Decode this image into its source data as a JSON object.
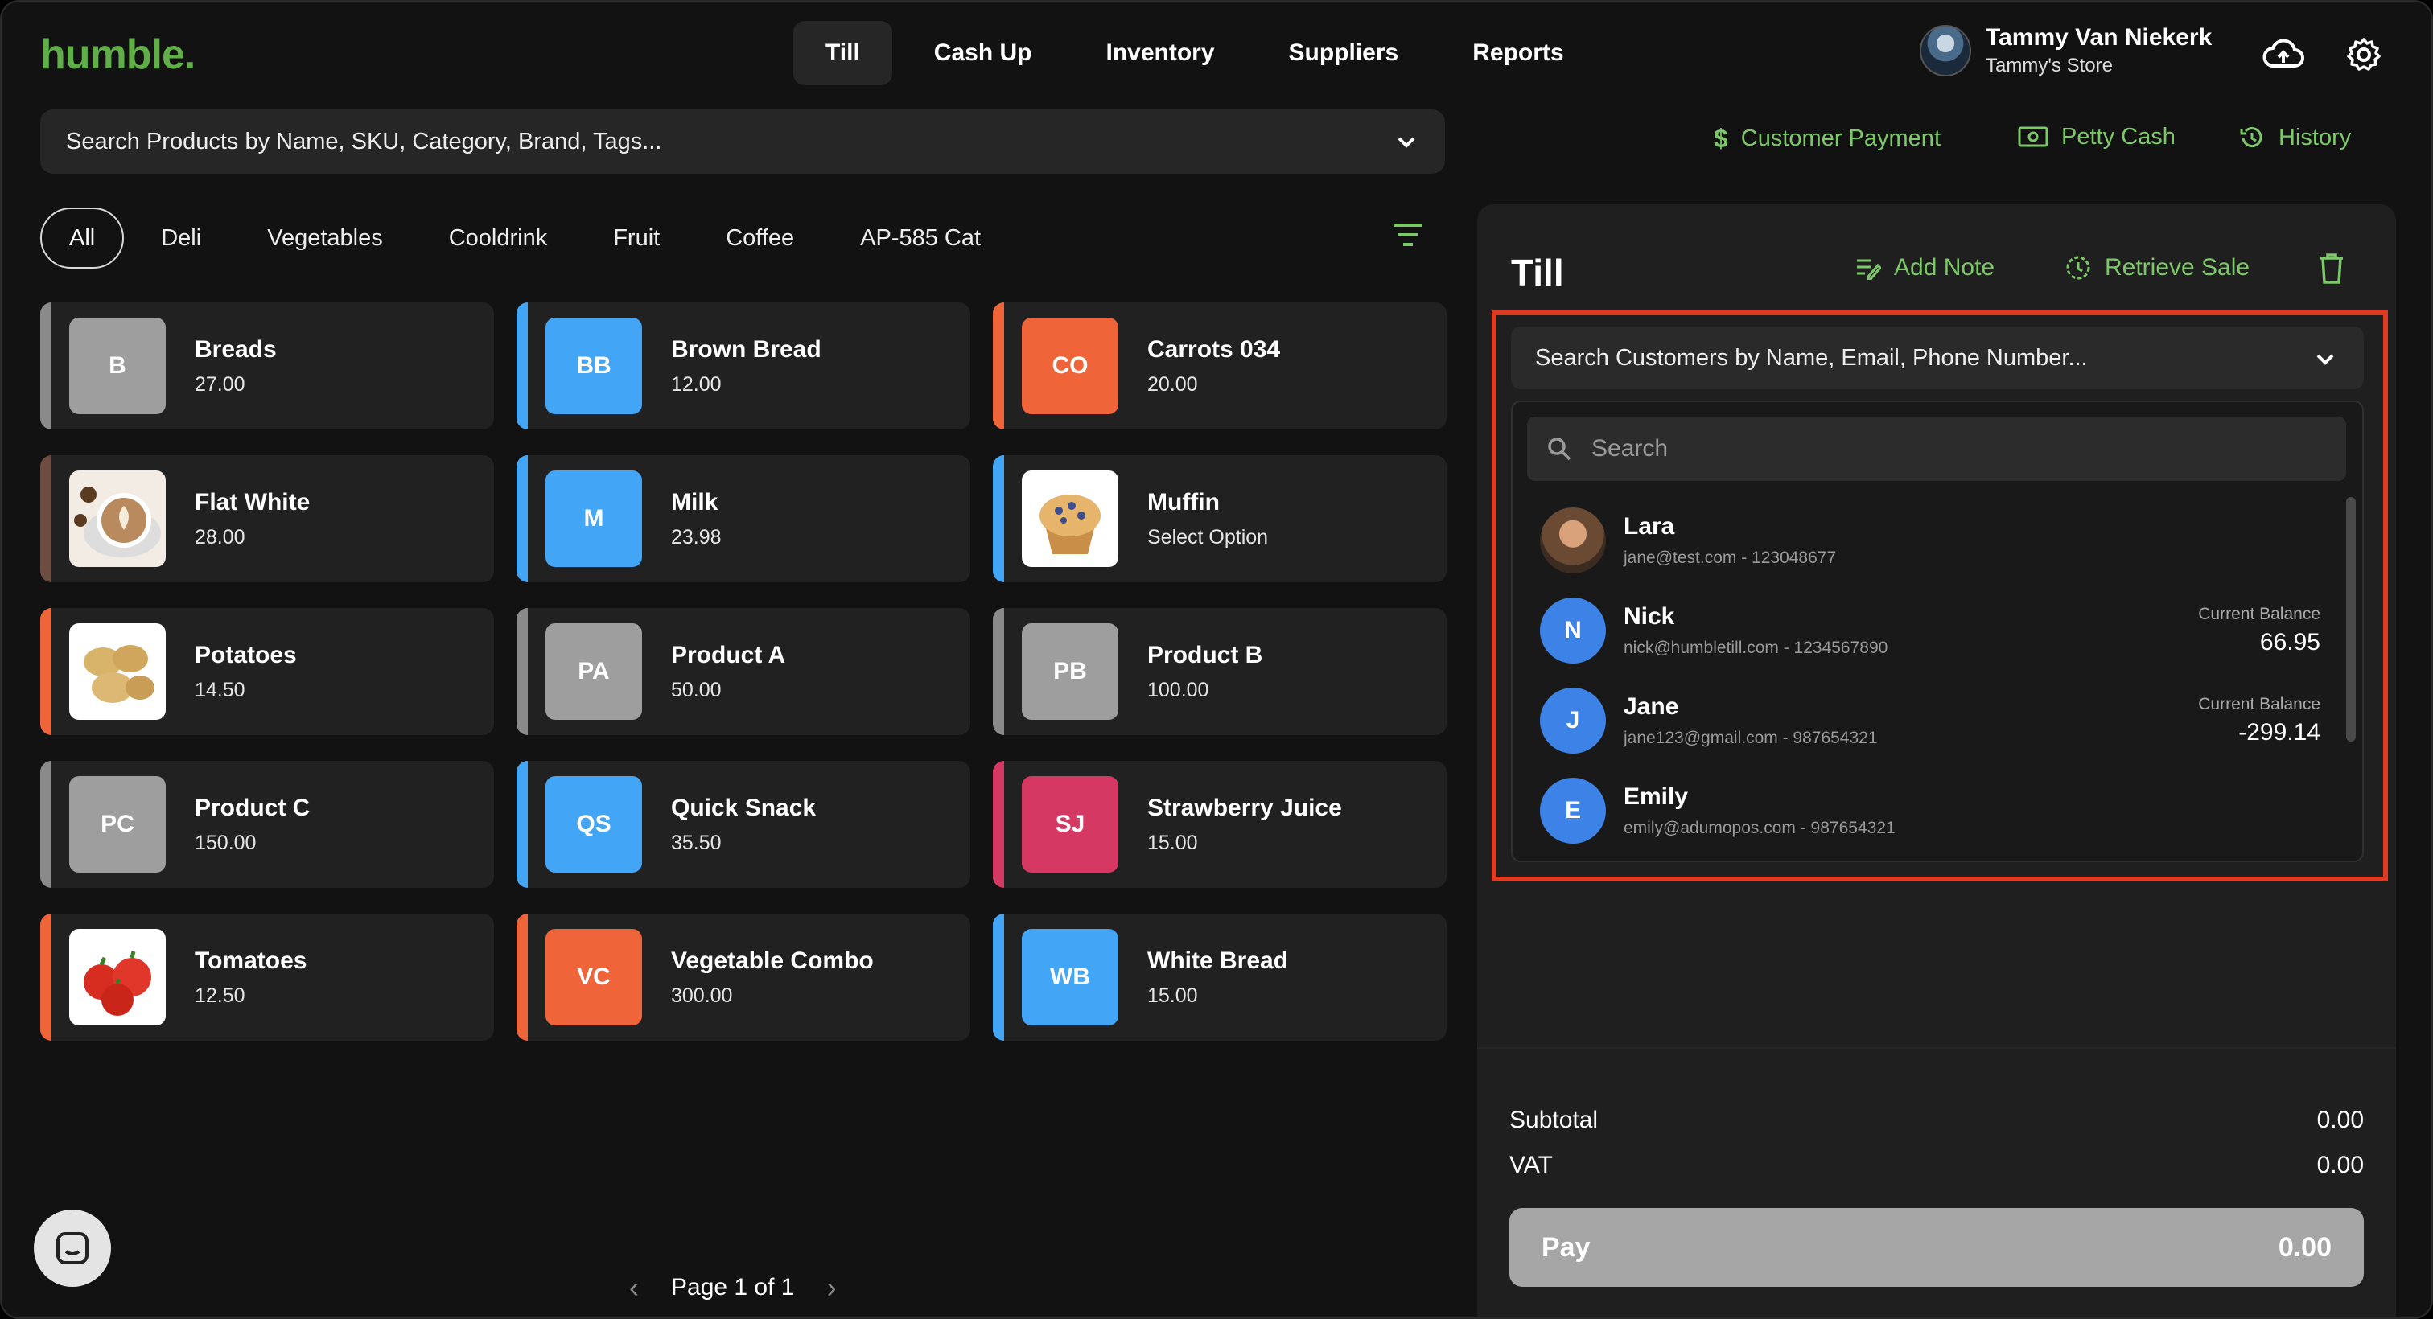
{
  "app": {
    "logo": "humble."
  },
  "nav": [
    {
      "label": "Till",
      "active": true
    },
    {
      "label": "Cash Up"
    },
    {
      "label": "Inventory"
    },
    {
      "label": "Suppliers"
    },
    {
      "label": "Reports"
    }
  ],
  "user": {
    "name": "Tammy Van Niekerk",
    "store": "Tammy's Store"
  },
  "product_search": {
    "placeholder": "Search Products by Name, SKU, Category, Brand, Tags..."
  },
  "quick_actions": {
    "customer_payment": "Customer Payment",
    "petty_cash": "Petty Cash",
    "history": "History"
  },
  "categories": [
    "All",
    "Deli",
    "Vegetables",
    "Cooldrink",
    "Fruit",
    "Coffee",
    "AP-585 Cat"
  ],
  "products": [
    {
      "initials": "B",
      "name": "Breads",
      "price": "27.00",
      "color": "#9e9e9e",
      "stripe": "#8a8a8a"
    },
    {
      "initials": "BB",
      "name": "Brown Bread",
      "price": "12.00",
      "color": "#42a5f5",
      "stripe": "#42a5f5"
    },
    {
      "initials": "CO",
      "name": "Carrots 034",
      "price": "20.00",
      "color": "#f0643a",
      "stripe": "#f0643a"
    },
    {
      "image": "coffee",
      "name": "Flat White",
      "price": "28.00",
      "stripe": "#6d4c41"
    },
    {
      "initials": "M",
      "name": "Milk",
      "price": "23.98",
      "color": "#42a5f5",
      "stripe": "#42a5f5"
    },
    {
      "image": "muffin",
      "name": "Muffin",
      "price": "Select Option",
      "stripe": "#42a5f5"
    },
    {
      "image": "potatoes",
      "name": "Potatoes",
      "price": "14.50",
      "stripe": "#f0643a"
    },
    {
      "initials": "PA",
      "name": "Product A",
      "price": "50.00",
      "color": "#9e9e9e",
      "stripe": "#8a8a8a"
    },
    {
      "initials": "PB",
      "name": "Product B",
      "price": "100.00",
      "color": "#9e9e9e",
      "stripe": "#8a8a8a"
    },
    {
      "initials": "PC",
      "name": "Product C",
      "price": "150.00",
      "color": "#9e9e9e",
      "stripe": "#8a8a8a"
    },
    {
      "initials": "QS",
      "name": "Quick Snack",
      "price": "35.50",
      "color": "#42a5f5",
      "stripe": "#42a5f5"
    },
    {
      "initials": "SJ",
      "name": "Strawberry Juice",
      "price": "15.00",
      "color": "#d63864",
      "stripe": "#d63864"
    },
    {
      "image": "tomatoes",
      "name": "Tomatoes",
      "price": "12.50",
      "stripe": "#f0643a"
    },
    {
      "initials": "VC",
      "name": "Vegetable Combo",
      "price": "300.00",
      "color": "#f0643a",
      "stripe": "#f0643a"
    },
    {
      "initials": "WB",
      "name": "White Bread",
      "price": "15.00",
      "color": "#42a5f5",
      "stripe": "#42a5f5"
    }
  ],
  "pagination": {
    "label": "Page 1 of 1"
  },
  "till": {
    "title": "Till",
    "add_note": "Add Note",
    "retrieve_sale": "Retrieve Sale",
    "customer_search_placeholder": "Search Customers by Name, Email, Phone Number...",
    "dropdown_search_placeholder": "Search",
    "customers": [
      {
        "name": "Lara",
        "sub": "jane@test.com - 123048677",
        "photo": true
      },
      {
        "initial": "N",
        "name": "Nick",
        "sub": "nick@humbletill.com - 1234567890",
        "balance_label": "Current Balance",
        "balance": "66.95"
      },
      {
        "initial": "J",
        "name": "Jane",
        "sub": "jane123@gmail.com - 987654321",
        "balance_label": "Current Balance",
        "balance": "-299.14"
      },
      {
        "initial": "E",
        "name": "Emily",
        "sub": "emily@adumopos.com - 987654321"
      }
    ],
    "subtotal_label": "Subtotal",
    "subtotal": "0.00",
    "vat_label": "VAT",
    "vat": "0.00",
    "pay_label": "Pay",
    "pay_amount": "0.00"
  }
}
